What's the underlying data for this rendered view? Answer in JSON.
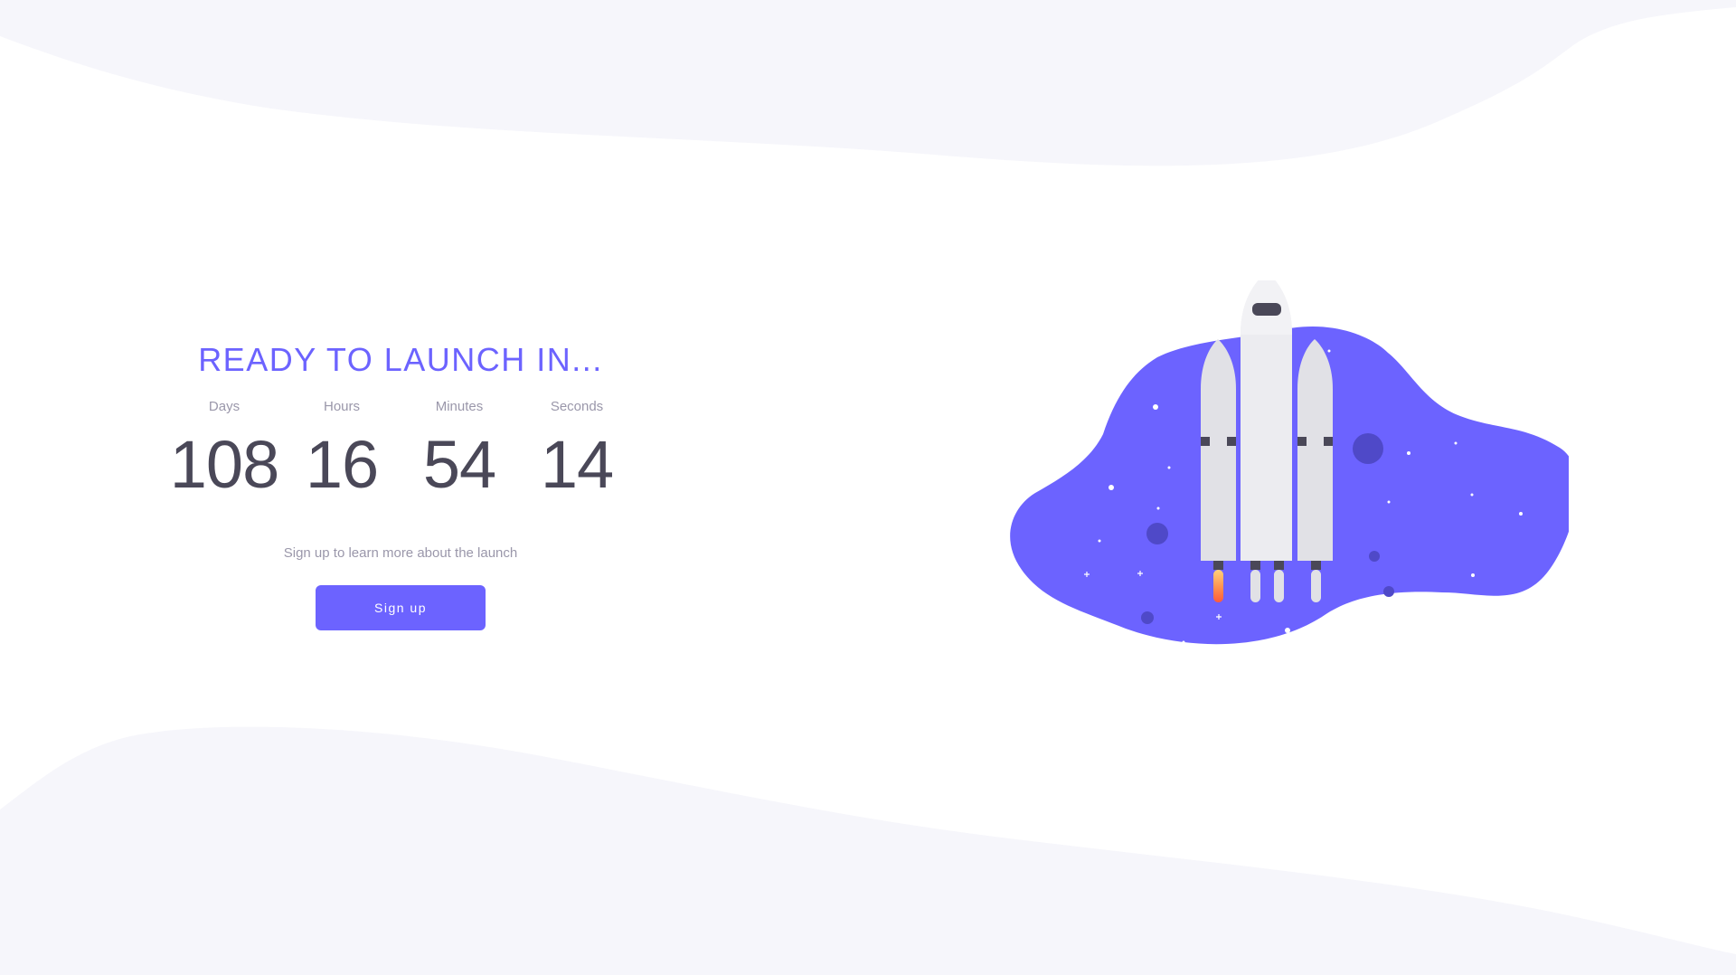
{
  "heading": "READY TO LAUNCH IN...",
  "countdown": {
    "days": {
      "label": "Days",
      "value": "108"
    },
    "hours": {
      "label": "Hours",
      "value": "16"
    },
    "minutes": {
      "label": "Minutes",
      "value": "54"
    },
    "seconds": {
      "label": "Seconds",
      "value": "14"
    }
  },
  "subtext": "Sign up to learn more about the launch",
  "signup_button": "Sign up",
  "colors": {
    "accent": "#6c63ff",
    "text_dark": "#4a4858",
    "text_muted": "#9a97aa",
    "wave_background": "#f6f6fb"
  },
  "illustration": {
    "icon": "rocket-icon"
  }
}
